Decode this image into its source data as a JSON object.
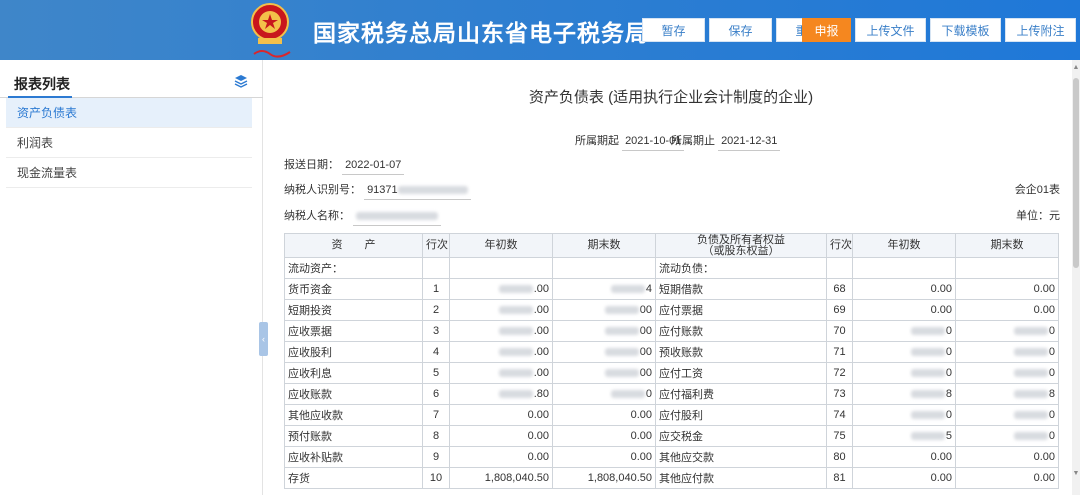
{
  "header": {
    "site_title": "国家税务总局山东省电子税务局",
    "emblem_sub": "中国税务",
    "buttons": [
      {
        "label": "暂存"
      },
      {
        "label": "保存"
      },
      {
        "label": "重置"
      },
      {
        "label": "申报",
        "active": true
      },
      {
        "label": "上传文件"
      },
      {
        "label": "下载模板"
      },
      {
        "label": "上传附注"
      }
    ]
  },
  "sidebar": {
    "title": "报表列表",
    "items": [
      {
        "label": "资产负债表",
        "active": true
      },
      {
        "label": "利润表"
      },
      {
        "label": "现金流量表"
      }
    ]
  },
  "form": {
    "title": "资产负债表 (适用执行企业会计制度的企业)",
    "period_start_label": "所属期起",
    "period_start": "2021-10-01",
    "period_end_label": "所属期止",
    "period_end": "2021-12-31",
    "report_date_label": "报送日期：",
    "report_date": "2022-01-07",
    "taxpayer_id_label": "纳税人识别号：",
    "taxpayer_id_visible": "91371",
    "form_code": "会企01表",
    "taxpayer_name_label": "纳税人名称：",
    "unit": "单位：元"
  },
  "table": {
    "headers": [
      "资　　产",
      "行次",
      "年初数",
      "期末数",
      "负债及所有者权益（或股东权益）",
      "行次",
      "年初数",
      "期末数"
    ],
    "header_right_line1": "负债及所有者权益",
    "header_right_line2": "（或股东权益）",
    "rows": [
      {
        "a_name": "流动资产：",
        "a_line": "",
        "a_begin": "",
        "a_end": "",
        "l_name": "流动负债：",
        "l_line": "",
        "l_begin": "",
        "l_end": "",
        "section": true
      },
      {
        "a_name": "货币资金",
        "a_line": "1",
        "a_begin": ".00",
        "a_end": "4",
        "l_name": "短期借款",
        "l_line": "68",
        "l_begin": "0.00",
        "l_end": "0.00"
      },
      {
        "a_name": "短期投资",
        "a_line": "2",
        "a_begin": ".00",
        "a_end": "00",
        "l_name": "应付票据",
        "l_line": "69",
        "l_begin": "0.00",
        "l_end": "0.00"
      },
      {
        "a_name": "应收票据",
        "a_line": "3",
        "a_begin": ".00",
        "a_end": "00",
        "l_name": "应付账款",
        "l_line": "70",
        "l_begin": "0",
        "l_end": "0"
      },
      {
        "a_name": "应收股利",
        "a_line": "4",
        "a_begin": ".00",
        "a_end": "00",
        "l_name": "预收账款",
        "l_line": "71",
        "l_begin": "0",
        "l_end": "0"
      },
      {
        "a_name": "应收利息",
        "a_line": "5",
        "a_begin": ".00",
        "a_end": "00",
        "l_name": "应付工资",
        "l_line": "72",
        "l_begin": "0",
        "l_end": "0"
      },
      {
        "a_name": "应收账款",
        "a_line": "6",
        "a_begin": ".80",
        "a_end": "0",
        "l_name": "应付福利费",
        "l_line": "73",
        "l_begin": "8",
        "l_end": "8"
      },
      {
        "a_name": "其他应收款",
        "a_line": "7",
        "a_begin": "0.00",
        "a_end": "0.00",
        "l_name": "应付股利",
        "l_line": "74",
        "l_begin": "0",
        "l_end": "0"
      },
      {
        "a_name": "预付账款",
        "a_line": "8",
        "a_begin": "0.00",
        "a_end": "0.00",
        "l_name": "应交税金",
        "l_line": "75",
        "l_begin": "5",
        "l_end": "0"
      },
      {
        "a_name": "应收补贴款",
        "a_line": "9",
        "a_begin": "0.00",
        "a_end": "0.00",
        "l_name": "其他应交款",
        "l_line": "80",
        "l_begin": "0.00",
        "l_end": "0.00"
      },
      {
        "a_name": "存货",
        "a_line": "10",
        "a_begin": "1,808,040.50",
        "a_end": "1,808,040.50",
        "l_name": "其他应付款",
        "l_line": "81",
        "l_begin": "0.00",
        "l_end": "0.00"
      }
    ]
  },
  "colors": {
    "header_blue": "#2f7fd0",
    "active_orange": "#f5871f",
    "accent": "#2c7ad2"
  }
}
